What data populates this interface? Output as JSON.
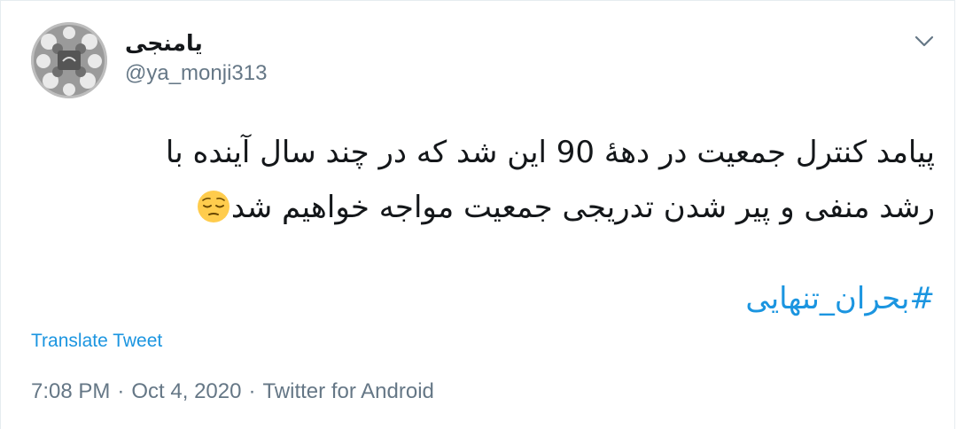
{
  "user": {
    "display_name": "یامنجی",
    "handle": "@ya_monji313"
  },
  "tweet": {
    "line1": "پیامد کنترل جمعیت در دههٔ 90 این شد که در چند سال آینده با",
    "line2": "رشد منفی و پیر شدن تدریجی جمعیت مواجه خواهیم شد",
    "emoji": "pensive-face",
    "hashtag": "#بحران_تنهایی"
  },
  "actions": {
    "translate": "Translate Tweet"
  },
  "meta": {
    "time": "7:08 PM",
    "separator": "·",
    "date": "Oct 4, 2020",
    "source": "Twitter for Android"
  },
  "icons": {
    "menu": "chevron-down-icon"
  },
  "colors": {
    "link": "#1b95e0",
    "secondary_text": "#657786",
    "primary_text": "#14171a"
  }
}
